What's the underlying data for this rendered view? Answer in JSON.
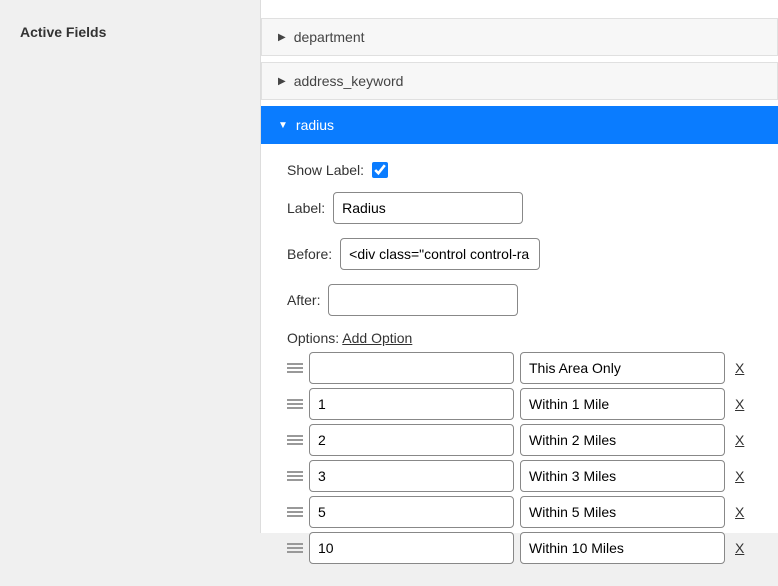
{
  "sidebar": {
    "title": "Active Fields"
  },
  "fields": {
    "f0": {
      "name": "department"
    },
    "f1": {
      "name": "address_keyword"
    },
    "f2": {
      "name": "radius"
    }
  },
  "form": {
    "show_label_text": "Show Label:",
    "show_label_checked": true,
    "label_text": "Label:",
    "label_value": "Radius",
    "before_text": "Before:",
    "before_value": "<div class=\"control control-ra",
    "after_text": "After:",
    "after_value": "",
    "options_text": "Options:",
    "add_option_text": "Add Option",
    "delete_text": "X"
  },
  "options": [
    {
      "value": "",
      "label": "This Area Only"
    },
    {
      "value": "1",
      "label": "Within 1 Mile"
    },
    {
      "value": "2",
      "label": "Within 2 Miles"
    },
    {
      "value": "3",
      "label": "Within 3 Miles"
    },
    {
      "value": "5",
      "label": "Within 5 Miles"
    },
    {
      "value": "10",
      "label": "Within 10 Miles"
    }
  ]
}
